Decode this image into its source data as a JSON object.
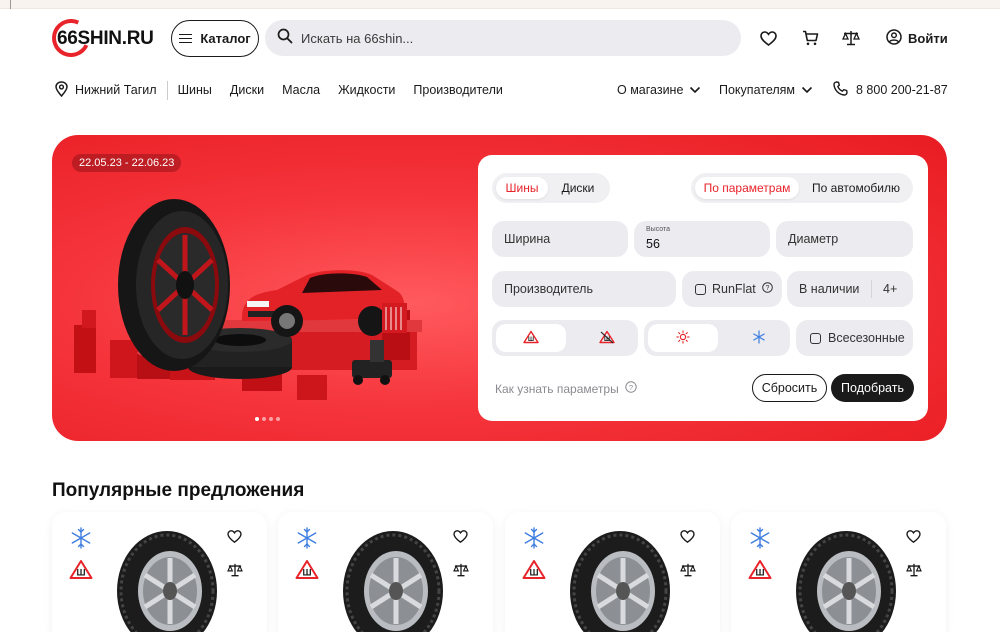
{
  "header": {
    "logo_text": "66SHIN.RU",
    "catalog_label": "Каталог",
    "search_placeholder": "Искать на 66shin...",
    "login_label": "Войти",
    "icons": [
      "heart-icon",
      "cart-icon",
      "scales-icon",
      "user-icon"
    ]
  },
  "nav": {
    "city": "Нижний Тагил",
    "links": [
      "Шины",
      "Диски",
      "Масла",
      "Жидкости",
      "Производители"
    ],
    "about": "О магазине",
    "buyers": "Покупателям",
    "phone": "8 800 200-21-87"
  },
  "banner": {
    "date_range": "22.05.23 - 22.06.23",
    "slides_total": 4,
    "slide_active": 1
  },
  "filter": {
    "type_tabs": [
      "Шины",
      "Диски"
    ],
    "type_active": "Шины",
    "mode_tabs": [
      "По параметрам",
      "По автомобилю"
    ],
    "mode_active": "По параметрам",
    "width_label": "Ширина",
    "height_caption": "Высота",
    "height_value": "56",
    "diameter_label": "Диаметр",
    "manufacturer_label": "Производитель",
    "runflat_label": "RunFlat",
    "availability_label": "В наличии",
    "availability_value": "4+",
    "allseason_label": "Всесезонные",
    "help_link": "Как узнать параметры",
    "reset_label": "Сбросить",
    "submit_label": "Подобрать",
    "colors": {
      "accent": "#e8232a",
      "dark": "#1a1a1a"
    }
  },
  "popular": {
    "title": "Популярные предложения",
    "cards": [
      {
        "season_icon": "snowflake-icon",
        "stud_badge": "Ш"
      },
      {
        "season_icon": "snowflake-icon",
        "stud_badge": "Ш"
      },
      {
        "season_icon": "snowflake-icon",
        "stud_badge": "Ш"
      },
      {
        "season_icon": "snowflake-icon",
        "stud_badge": "Ш"
      }
    ]
  }
}
